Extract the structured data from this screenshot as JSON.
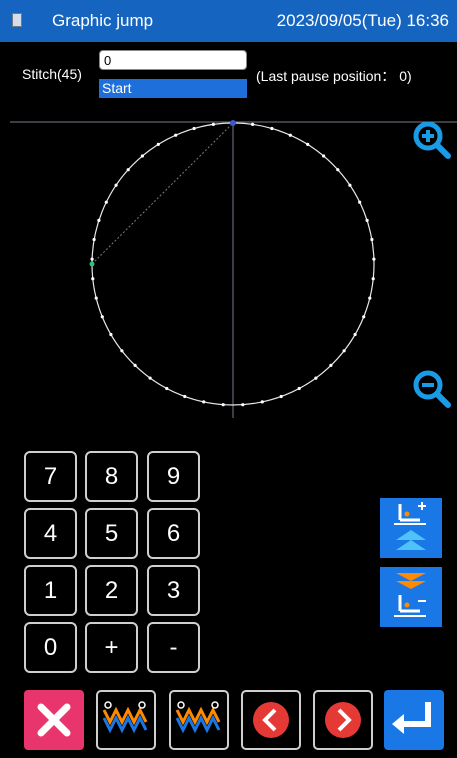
{
  "header": {
    "title": "Graphic jump",
    "datetime": "2023/09/05(Tue) 16:36"
  },
  "stitch": {
    "label": "Stitch(45)",
    "value": "0",
    "dropdown_option": "Start",
    "pause_info": "(Last pause position： 0)"
  },
  "keypad": {
    "keys": [
      "7",
      "8",
      "9",
      "4",
      "5",
      "6",
      "1",
      "2",
      "3",
      "0",
      "+",
      "-"
    ]
  },
  "icons": {
    "zoom_in": "zoom-in-icon",
    "zoom_out": "zoom-out-icon",
    "needle_up": "needle-forward-icon",
    "needle_down": "needle-backward-icon",
    "cancel": "close-icon",
    "stitch_a": "zigzag-stitch-icon",
    "stitch_b": "zigzag-stitch-icon",
    "prev": "chevron-left-icon",
    "next": "chevron-right-icon",
    "enter": "enter-icon"
  },
  "colors": {
    "titlebar": "#1565c0",
    "accent": "#1a78e6",
    "cancel": "#e8356d",
    "nav_red": "#e53935"
  }
}
